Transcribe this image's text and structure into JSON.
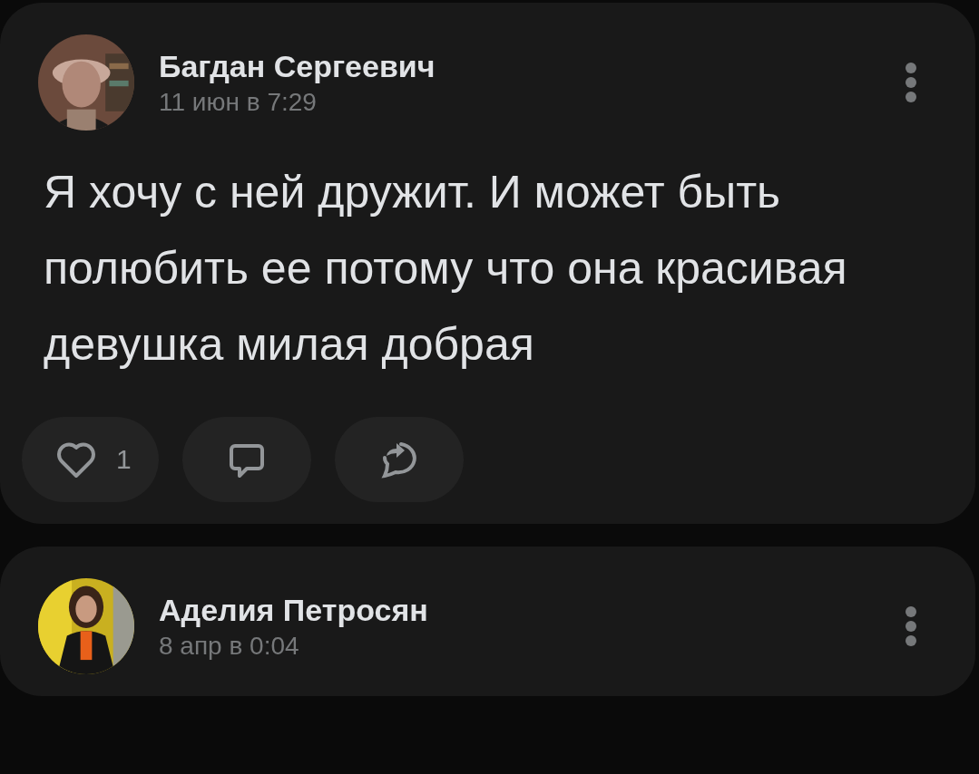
{
  "posts": [
    {
      "author": "Багдан Сергеевич",
      "date": "11 июн в 7:29",
      "text": "Я хочу с ней дружит. И может быть полюбить ее потому что она красивая девушка милая добрая",
      "actions": [
        {
          "kind": "like",
          "count": "1"
        },
        {
          "kind": "comment"
        },
        {
          "kind": "share"
        }
      ]
    },
    {
      "author": "Аделия Петросян",
      "date": "8 апр в 0:04"
    }
  ]
}
